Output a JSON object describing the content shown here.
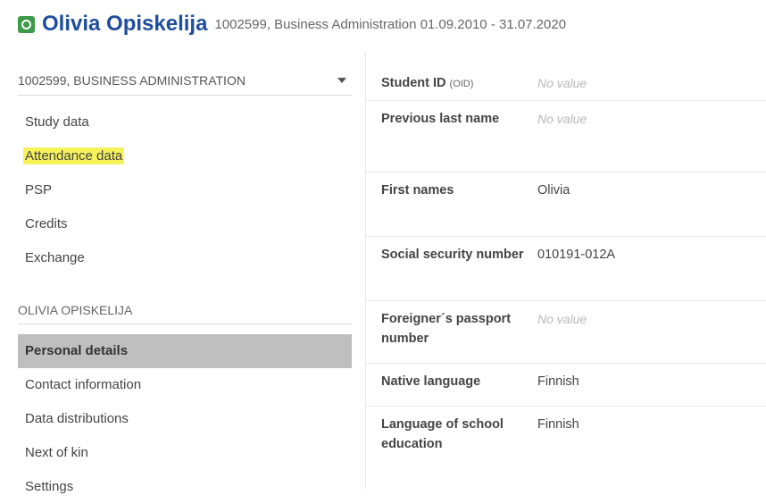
{
  "header": {
    "name": "Olivia Opiskelija",
    "meta": "1002599, Business Administration 01.09.2010 - 31.07.2020",
    "status_icon": "active-status-icon",
    "status_color": "#3c9a4a",
    "name_color": "#1f4e9c"
  },
  "sidebar": {
    "study_right": "1002599, BUSINESS ADMINISTRATION",
    "study_items": [
      {
        "label": "Study data"
      },
      {
        "label": "Attendance data"
      },
      {
        "label": "PSP"
      },
      {
        "label": "Credits"
      },
      {
        "label": "Exchange"
      }
    ],
    "person_section": "OLIVIA OPISKELIJA",
    "person_items": [
      {
        "label": "Personal details"
      },
      {
        "label": "Contact information"
      },
      {
        "label": "Data distributions"
      },
      {
        "label": "Next of kin"
      },
      {
        "label": "Settings"
      }
    ],
    "highlight_color": "#f6f35a",
    "active_bg": "#bfbfbf"
  },
  "details": {
    "student_id": {
      "label": "Student ID",
      "sub": "(OID)",
      "value": "No value"
    },
    "previous_last_name": {
      "label": "Previous last name",
      "value": "No value"
    },
    "first_names": {
      "label": "First names",
      "value": "Olivia"
    },
    "ssn": {
      "label": "Social security number",
      "value": "010191-012A"
    },
    "passport": {
      "label": "Foreigner´s passport number",
      "value": "No value"
    },
    "native_language": {
      "label": "Native language",
      "value": "Finnish"
    },
    "school_language": {
      "label": "Language of school education",
      "value": "Finnish"
    }
  }
}
